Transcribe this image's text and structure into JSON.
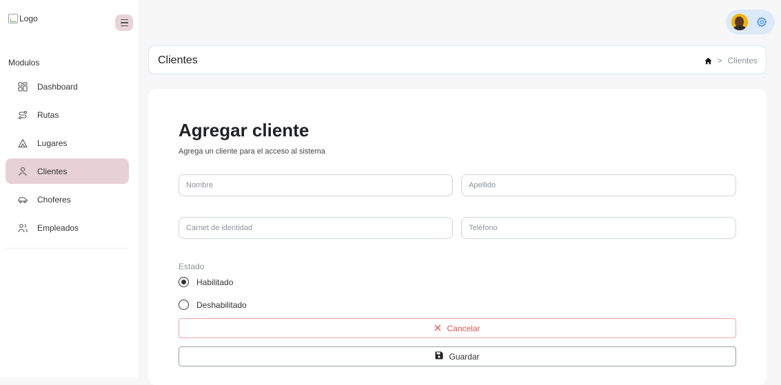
{
  "sidebar": {
    "logo_alt": "Logo",
    "section_title": "Modulos",
    "items": [
      {
        "label": "Dashboard",
        "icon": "dashboard-icon",
        "active": false
      },
      {
        "label": "Rutas",
        "icon": "route-icon",
        "active": false
      },
      {
        "label": "Lugares",
        "icon": "place-icon",
        "active": false
      },
      {
        "label": "Clientes",
        "icon": "user-icon",
        "active": true
      },
      {
        "label": "Choferes",
        "icon": "car-icon",
        "active": false
      },
      {
        "label": "Empleados",
        "icon": "users-icon",
        "active": false
      }
    ]
  },
  "header": {
    "title": "Clientes",
    "breadcrumb_separator": ">",
    "breadcrumb_current": "Clientes"
  },
  "form": {
    "title": "Agregar cliente",
    "subtitle": "Agrega un cliente para el acceso al sistema",
    "fields": {
      "nombre": {
        "placeholder": "Nombre",
        "value": ""
      },
      "apellido": {
        "placeholder": "Apellido",
        "value": ""
      },
      "carnet": {
        "placeholder": "Carnet de identidad",
        "value": ""
      },
      "telefono": {
        "placeholder": "Teléfono",
        "value": ""
      }
    },
    "estado_label": "Estado",
    "estado_options": [
      {
        "label": "Habilitado",
        "selected": true
      },
      {
        "label": "Deshabilitado",
        "selected": false
      }
    ],
    "cancel_label": "Cancelar",
    "save_label": "Guardar"
  },
  "colors": {
    "accent": "#e6d1d6",
    "cancel": "#e05252",
    "user_pill": "#dbeaf8",
    "settings_icon": "#3b82f6"
  }
}
